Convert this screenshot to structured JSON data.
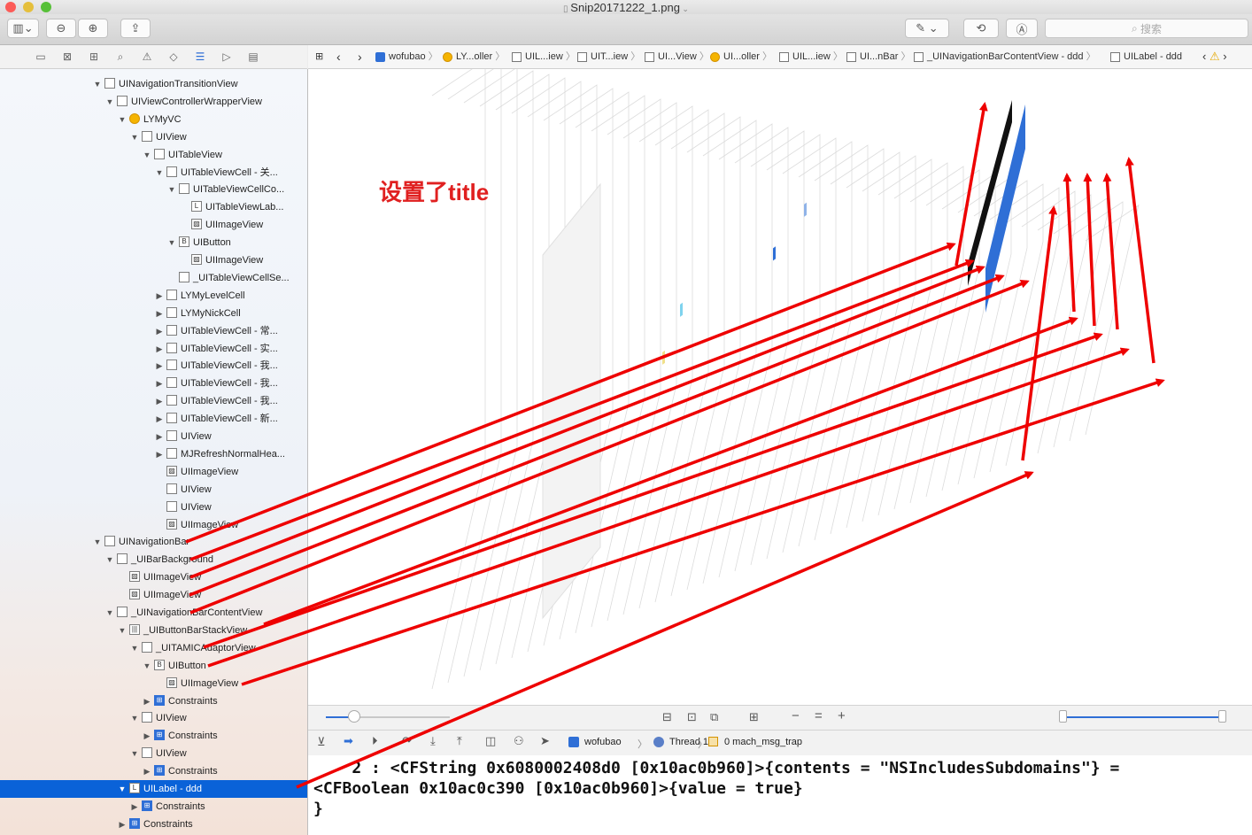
{
  "window": {
    "title": "Snip20171222_1.png"
  },
  "toolbar": {
    "search_placeholder": "搜索"
  },
  "tree": [
    {
      "label": "UINavigationTransitionView",
      "indent": 0,
      "icon": "view",
      "disc": "down"
    },
    {
      "label": "UIViewControllerWrapperView",
      "indent": 1,
      "icon": "view",
      "disc": "down"
    },
    {
      "label": "LYMyVC",
      "indent": 2,
      "icon": "vc",
      "disc": "down"
    },
    {
      "label": "UIView",
      "indent": 3,
      "icon": "view",
      "disc": "down"
    },
    {
      "label": "UITableView",
      "indent": 4,
      "icon": "view",
      "disc": "down"
    },
    {
      "label": "UITableViewCell - 关...",
      "indent": 5,
      "icon": "view",
      "disc": "down"
    },
    {
      "label": "UITableViewCellCo...",
      "indent": 6,
      "icon": "view",
      "disc": "down"
    },
    {
      "label": "UITableViewLab...",
      "indent": 7,
      "icon": "label",
      "disc": ""
    },
    {
      "label": "UIImageView",
      "indent": 7,
      "icon": "image",
      "disc": ""
    },
    {
      "label": "UIButton",
      "indent": 6,
      "icon": "button",
      "disc": "down"
    },
    {
      "label": "UIImageView",
      "indent": 7,
      "icon": "image",
      "disc": ""
    },
    {
      "label": "_UITableViewCellSe...",
      "indent": 6,
      "icon": "view",
      "disc": ""
    },
    {
      "label": "LYMyLevelCell",
      "indent": 5,
      "icon": "view",
      "disc": "right"
    },
    {
      "label": "LYMyNickCell",
      "indent": 5,
      "icon": "view",
      "disc": "right"
    },
    {
      "label": "UITableViewCell - 常...",
      "indent": 5,
      "icon": "view",
      "disc": "right"
    },
    {
      "label": "UITableViewCell - 实...",
      "indent": 5,
      "icon": "view",
      "disc": "right"
    },
    {
      "label": "UITableViewCell - 我...",
      "indent": 5,
      "icon": "view",
      "disc": "right"
    },
    {
      "label": "UITableViewCell - 我...",
      "indent": 5,
      "icon": "view",
      "disc": "right"
    },
    {
      "label": "UITableViewCell - 我...",
      "indent": 5,
      "icon": "view",
      "disc": "right"
    },
    {
      "label": "UITableViewCell - 新...",
      "indent": 5,
      "icon": "view",
      "disc": "right"
    },
    {
      "label": "UIView",
      "indent": 5,
      "icon": "view",
      "disc": "right"
    },
    {
      "label": "MJRefreshNormalHea...",
      "indent": 5,
      "icon": "view",
      "disc": "right"
    },
    {
      "label": "UIImageView",
      "indent": 5,
      "icon": "image",
      "disc": ""
    },
    {
      "label": "UIView",
      "indent": 5,
      "icon": "view",
      "disc": ""
    },
    {
      "label": "UIView",
      "indent": 5,
      "icon": "view",
      "disc": ""
    },
    {
      "label": "UIImageView",
      "indent": 5,
      "icon": "image",
      "disc": ""
    },
    {
      "label": "UINavigationBar",
      "indent": 0,
      "icon": "navbar",
      "disc": "down"
    },
    {
      "label": "_UIBarBackground",
      "indent": 1,
      "icon": "view",
      "disc": "down"
    },
    {
      "label": "UIImageView",
      "indent": 2,
      "icon": "image",
      "disc": ""
    },
    {
      "label": "UIImageView",
      "indent": 2,
      "icon": "image",
      "disc": ""
    },
    {
      "label": "_UINavigationBarContentView",
      "indent": 1,
      "icon": "view",
      "disc": "down"
    },
    {
      "label": "_UIButtonBarStackView",
      "indent": 2,
      "icon": "stack",
      "disc": "down"
    },
    {
      "label": "_UITAMICAdaptorView",
      "indent": 3,
      "icon": "view",
      "disc": "down"
    },
    {
      "label": "UIButton",
      "indent": 4,
      "icon": "button",
      "disc": "down"
    },
    {
      "label": "UIImageView",
      "indent": 5,
      "icon": "image",
      "disc": ""
    },
    {
      "label": "Constraints",
      "indent": 4,
      "icon": "cons",
      "disc": "right"
    },
    {
      "label": "UIView",
      "indent": 3,
      "icon": "view",
      "disc": "down"
    },
    {
      "label": "Constraints",
      "indent": 4,
      "icon": "cons",
      "disc": "right"
    },
    {
      "label": "UIView",
      "indent": 3,
      "icon": "view",
      "disc": "down"
    },
    {
      "label": "Constraints",
      "indent": 4,
      "icon": "cons",
      "disc": "right"
    },
    {
      "label": "UILabel - ddd",
      "indent": 2,
      "icon": "label",
      "disc": "down",
      "selected": true
    },
    {
      "label": "Constraints",
      "indent": 3,
      "icon": "cons",
      "disc": "right"
    },
    {
      "label": "Constraints",
      "indent": 2,
      "icon": "cons",
      "disc": "right"
    }
  ],
  "breadcrumbs": [
    {
      "label": "wofubao",
      "icon": "app"
    },
    {
      "label": "LY...oller",
      "icon": "vc"
    },
    {
      "label": "UIL...iew",
      "icon": "view"
    },
    {
      "label": "UIT...iew",
      "icon": "view"
    },
    {
      "label": "UI...View",
      "icon": "view"
    },
    {
      "label": "UI...oller",
      "icon": "vc"
    },
    {
      "label": "UIL...iew",
      "icon": "view"
    },
    {
      "label": "UI...nBar",
      "icon": "view"
    },
    {
      "label": "_UINavigationBarContentView - ddd",
      "icon": "view"
    },
    {
      "label": "UILabel - ddd",
      "icon": "label"
    }
  ],
  "annotation": {
    "text": "设置了title",
    "color": "#e02020"
  },
  "debug": {
    "app": "wofubao",
    "thread": "Thread 1",
    "frame": "0 mach_msg_trap"
  },
  "console": {
    "line1": "    2 : <CFString 0x6080002408d0 [0x10ac0b960]>{contents = \"NSIncludesSubdomains\"} =",
    "line2": "<CFBoolean 0x10ac0c390 [0x10ac0b960]>{value = true}",
    "line3": "}"
  },
  "colors": {
    "selection": "#0a62d8",
    "arrow": "#ee0000",
    "accent_blue": "#2f6fd6"
  }
}
